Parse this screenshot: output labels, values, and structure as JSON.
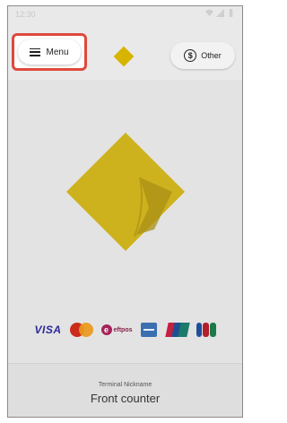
{
  "status_bar": {
    "time": "12:30",
    "icons": [
      "wifi-icon",
      "signal-icon",
      "battery-icon"
    ]
  },
  "header": {
    "menu_label": "Menu",
    "other_label": "Other",
    "logo_icon": "commbank-diamond-logo"
  },
  "payment_methods": [
    "VISA",
    "mastercard-logo",
    "eftpos",
    "amex-logo",
    "unionpay-logo",
    "jcb-logo"
  ],
  "payment_text": {
    "visa": "VISA",
    "eftpos": "eftpos"
  },
  "footer": {
    "nickname_label": "Terminal Nickname",
    "nickname_value": "Front counter"
  },
  "colors": {
    "brand_yellow": "#ffcc00",
    "highlight": "#e0483d",
    "background_dim": "#e3e3e3"
  }
}
